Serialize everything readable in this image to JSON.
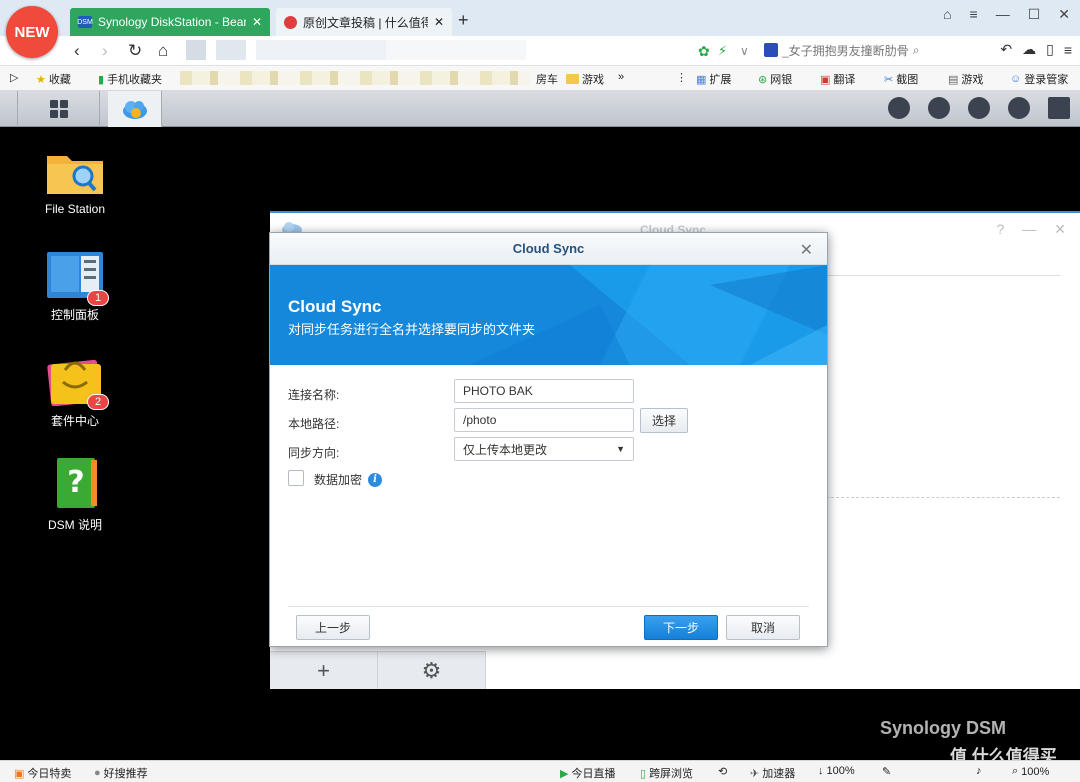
{
  "browser": {
    "new_badge": "NEW",
    "tabs": [
      {
        "label": "Synology DiskStation - BearDi",
        "favicon": "DSM"
      },
      {
        "label": "原创文章投稿 | 什么值得买",
        "favicon": ""
      }
    ],
    "new_tab": "+",
    "search_placeholder": "_女子拥抱男友撞断肋骨",
    "bookmarks": {
      "favorites": "收藏",
      "mobile": "手机收藏夹",
      "car": "房车",
      "games": "游戏",
      "more": "»",
      "ext": "扩展",
      "bank": "网银",
      "translate": "翻译",
      "screenshot": "截图",
      "games2": "游戏",
      "login": "登录管家"
    }
  },
  "desktop": {
    "icons": [
      {
        "label": "File Station",
        "badge": ""
      },
      {
        "label": "控制面板",
        "badge": "1"
      },
      {
        "label": "套件中心",
        "badge": "2"
      },
      {
        "label": "DSM 说明",
        "badge": ""
      }
    ]
  },
  "bg_window": {
    "title": "Cloud Sync",
    "help": "?",
    "minimize": "—",
    "close": "✕"
  },
  "dialog": {
    "title": "Cloud Sync",
    "close": "✕",
    "banner_title": "Cloud Sync",
    "banner_subtitle": "对同步任务进行全名并选择要同步的文件夹",
    "fields": {
      "name_label": "连接名称:",
      "name_value": "PHOTO BAK",
      "path_label": "本地路径:",
      "path_value": "/photo",
      "select_btn": "选择",
      "dir_label": "同步方向:",
      "dir_value": "仅上传本地更改",
      "encrypt_label": "数据加密"
    },
    "buttons": {
      "prev": "上一步",
      "next": "下一步",
      "cancel": "取消"
    }
  },
  "statusbar": {
    "today_deals": "今日特卖",
    "recommend": "好搜推荐",
    "live": "今日直播",
    "cross_screen": "跨屏浏览",
    "accelerator": "加速器",
    "zoom_dl": "100%",
    "zoom": "100%"
  },
  "watermark": {
    "brand": "Synology DSM",
    "site": "值 什么值得买"
  }
}
